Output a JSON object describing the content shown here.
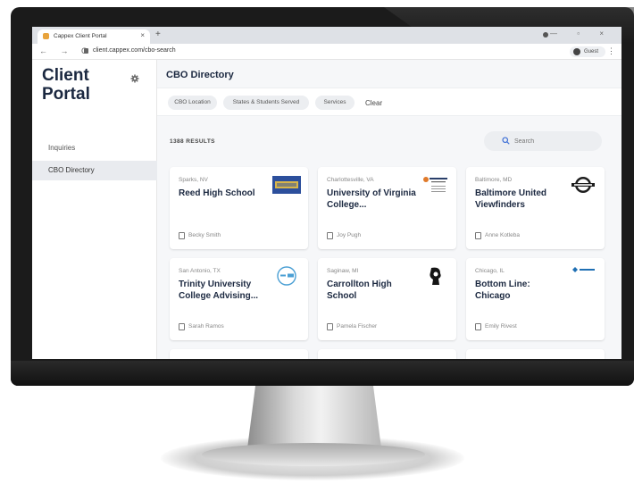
{
  "browser": {
    "tab_title": "Cappex Client Portal",
    "tab_close": "×",
    "new_tab": "+",
    "nav_icons": "← → C",
    "url": "client.cappex.com/cbo-search",
    "guest_label": "Guest",
    "menu_dots": "⋮",
    "window_controls": "— ▫ ×"
  },
  "sidebar": {
    "logo_line1": "Client",
    "logo_line2": "Portal",
    "items": [
      {
        "label": "Inquiries"
      },
      {
        "label": "CBO Directory"
      }
    ]
  },
  "main": {
    "page_title": "CBO Directory",
    "filters": [
      "CBO Location",
      "States & Students Served",
      "Services"
    ],
    "clear_label": "Clear",
    "results_count": "1388 RESULTS",
    "search_placeholder": "Search"
  },
  "cards": [
    {
      "location": "Sparks, NV",
      "name": "Reed High School",
      "contact": "Becky Smith"
    },
    {
      "location": "Charlottesville, VA",
      "name": "University of Virginia College...",
      "contact": "Joy Pugh"
    },
    {
      "location": "Baltimore, MD",
      "name": "Baltimore United Viewfinders",
      "contact": "Anne Kotleba"
    },
    {
      "location": "San Antonio, TX",
      "name": "Trinity University College Advising...",
      "contact": "Sarah Ramos"
    },
    {
      "location": "Saginaw, MI",
      "name": "Carrollton High School",
      "contact": "Pamela Fischer"
    },
    {
      "location": "Chicago, IL",
      "name": "Bottom Line: Chicago",
      "contact": "Emily Rivest"
    }
  ],
  "colors": {
    "heading": "#1b2840",
    "app_background": "#f6f7f9",
    "chip_background": "#eceef1",
    "search_accent": "#3d6fd6",
    "favicon": "#e8a33c"
  }
}
